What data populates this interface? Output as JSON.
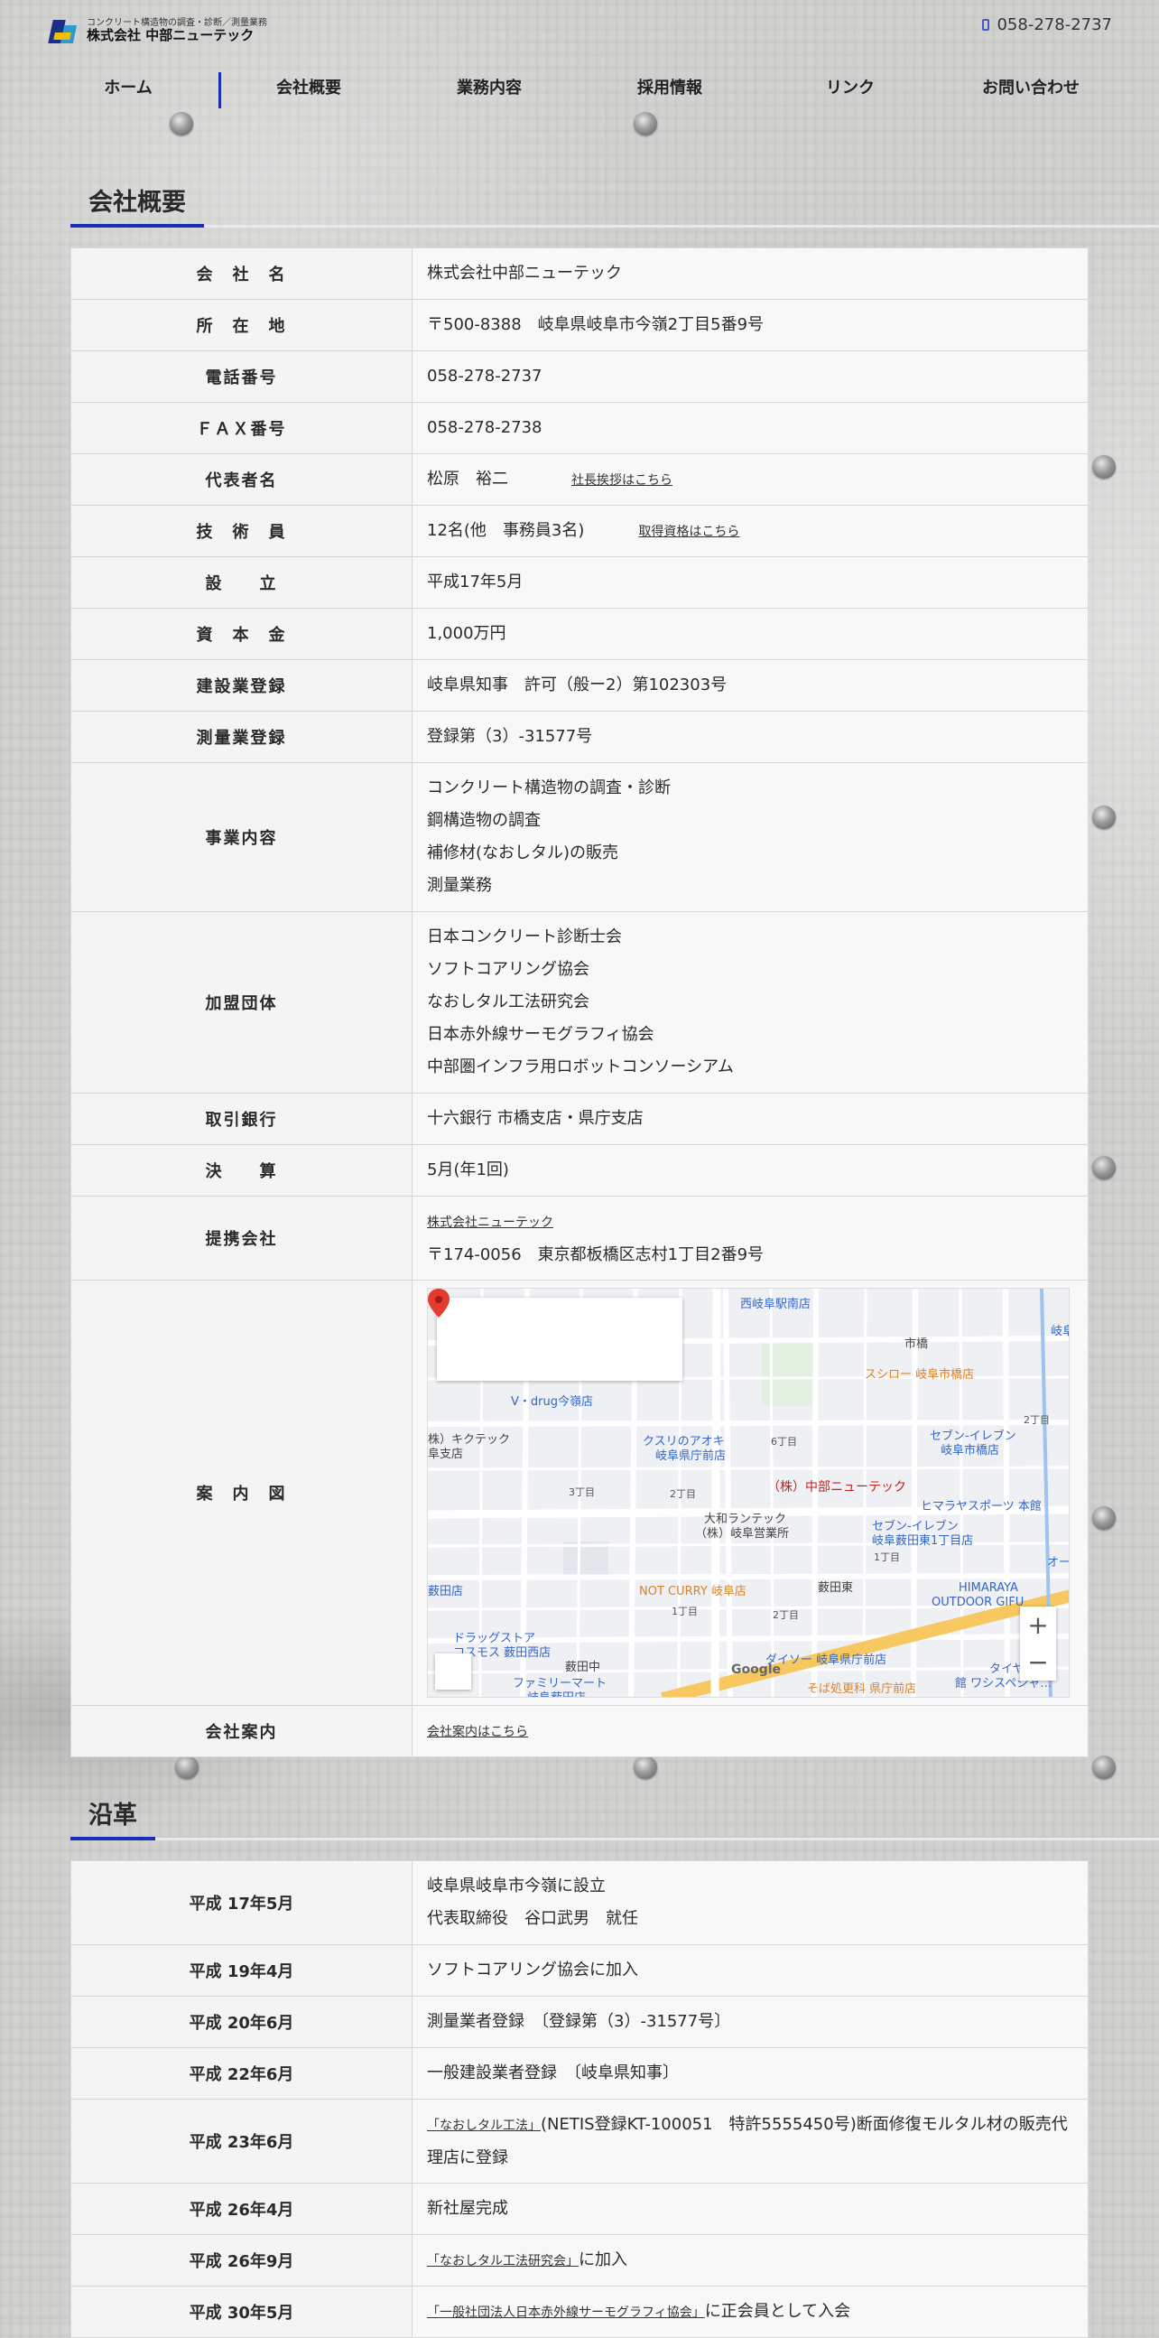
{
  "header": {
    "logo_sub": "コンクリート構造物の調査・診断／測量業務",
    "logo_main": "株式会社 中部ニューテック",
    "tel": "058-278-2737"
  },
  "nav": [
    "ホーム",
    "会社概要",
    "業務内容",
    "採用情報",
    "リンク",
    "お問い合わせ"
  ],
  "overview": {
    "title": "会社概要",
    "company_name_label": "会　社　名",
    "company_name": "株式会社中部ニューテック",
    "address_label": "所　在　地",
    "address": "〒500-8388　岐阜県岐阜市今嶺2丁目5番9号",
    "tel_label": "電話番号",
    "tel": "058-278-2737",
    "fax_label": "ＦＡＸ番号",
    "fax": "058-278-2738",
    "rep_label": "代表者名",
    "rep": "松原　裕二",
    "rep_link": "社長挨拶はこちら",
    "eng_label": "技　術　員",
    "eng": "12名(他　事務員3名)",
    "eng_link": "取得資格はこちら",
    "est_label": "設　　立",
    "est": "平成17年5月",
    "capital_label": "資　本　金",
    "capital": "1,000万円",
    "construction_label": "建設業登録",
    "construction": "岐阜県知事　許可（般ー2）第102303号",
    "survey_label": "測量業登録",
    "survey": "登録第（3）-31577号",
    "business_label": "事業内容",
    "business": [
      "コンクリート構造物の調査・診断",
      "鋼構造物の調査",
      "補修材(なおしタル)の販売",
      "測量業務"
    ],
    "assoc_label": "加盟団体",
    "assoc": [
      "日本コンクリート診断士会",
      "ソフトコアリング協会",
      "なおしタル工法研究会",
      "日本赤外線サーモグラフィ協会",
      "中部圏インフラ用ロボットコンソーシアム"
    ],
    "bank_label": "取引銀行",
    "bank": "十六銀行 市橋支店・県庁支店",
    "fiscal_label": "決　　算",
    "fiscal": "5月(年1回)",
    "partner_label": "提携会社",
    "partner_name": "株式会社ニューテック",
    "partner_address": "〒174-0056　東京都板橋区志村1丁目2番9号",
    "map_label": "案　内　図",
    "guide_label": "会社案内",
    "guide_link": "会社案内はこちら"
  },
  "map": {
    "labels": {
      "nishigifu": "西岐阜駅南店",
      "gifu": "岐阜",
      "ichihashi": "市橋",
      "sushiro": "スシロー 岐阜市橋店",
      "vdrug": "V・drug今嶺店",
      "kikutech": "株）キクテック",
      "kikutech2": "阜支店",
      "aoki": "クスリのアオキ",
      "aoki2": "岐阜県庁前店",
      "seven1": "セブン-イレブン",
      "seven1b": "岐阜市橋店",
      "rokuchome": "6丁目",
      "nichome": "2丁目",
      "sanchome": "3丁目",
      "nichome2": "2丁目",
      "company": "（株）中部ニューテック",
      "himaraya": "ヒマラヤスポーツ 本館",
      "daiwa": "大和ランテック",
      "daiwa2": "（株）岐阜営業所",
      "seven2": "セブン-イレブン",
      "seven2b": "岐阜薮田東1丁目店",
      "itchome": "1丁目",
      "yabuta": "薮田店",
      "notcurry": "NOT CURRY 岐阜店",
      "yabutahigashi": "薮田東",
      "himaraya2": "HIMARAYA",
      "himaraya3": "OUTDOOR GIFU",
      "itchome2": "1丁目",
      "nichome3": "2丁目",
      "dragstore": "ドラッグストア",
      "cosmos": "コスモス 薮田西店",
      "daiso": "ダイソー 岐阜県庁前店",
      "yabutanaka": "薮田中",
      "familymart": "ファミリーマート",
      "familymart2": "岐阜薮田店",
      "soba": "そば処更科 県庁前店",
      "taiya": "タイヤ&ホ",
      "taiya2": "館 ワシスペシャ…",
      "ohto": "オート",
      "google": "Google"
    }
  },
  "history": {
    "title": "沿革",
    "rows": [
      {
        "date": "平成 17年5月",
        "lines": [
          "岐阜県岐阜市今嶺に設立",
          "代表取締役　谷口武男　就任"
        ]
      },
      {
        "date": "平成 19年4月",
        "lines": [
          "ソフトコアリング協会に加入"
        ]
      },
      {
        "date": "平成 20年6月",
        "lines": [
          "測量業者登録　〔登録第（3）-31577号〕"
        ]
      },
      {
        "date": "平成 22年6月",
        "lines": [
          "一般建設業者登録　〔岐阜県知事〕"
        ]
      },
      {
        "date": "平成 23年6月",
        "link": "「なおしタル工法」",
        "text": "(NETIS登録KT-100051　特許5555450号)断面修復モルタル材の販売代理店に登録"
      },
      {
        "date": "平成 26年4月",
        "lines": [
          "新社屋完成"
        ]
      },
      {
        "date": "平成 26年9月",
        "link": "「なおしタル工法研究会」",
        "text": "に加入"
      },
      {
        "date": "平成 30年5月",
        "link": "「一般社団法人日本赤外線サーモグラフィ協会」",
        "text": "に正会員として入会"
      }
    ]
  }
}
